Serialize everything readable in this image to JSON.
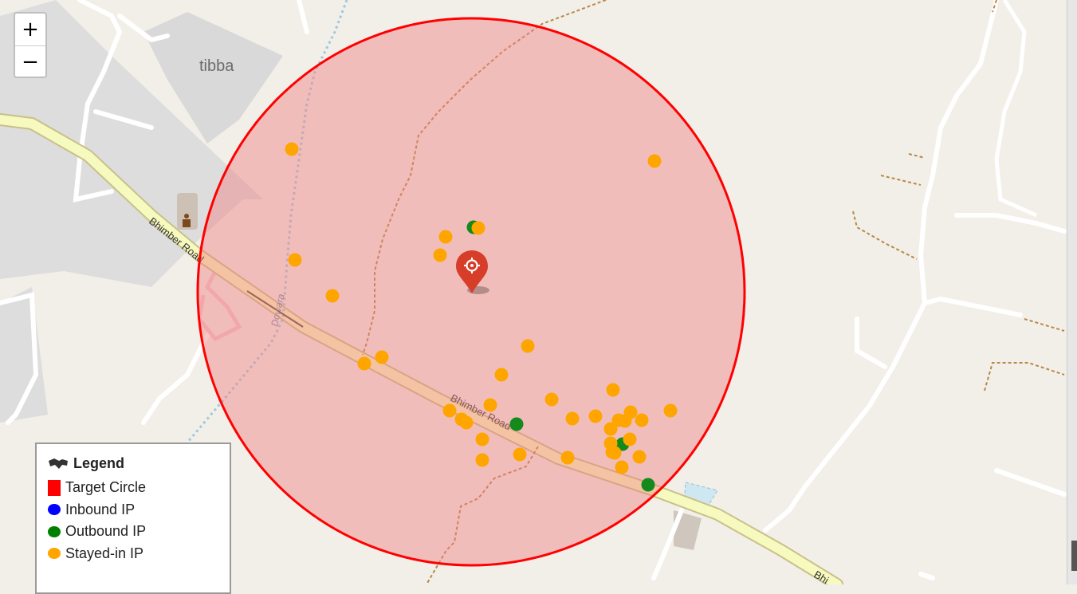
{
  "map": {
    "place_label": "tibba",
    "road_label_1": "Bhimber Road",
    "road_label_2": "Bhimber Road",
    "road_label_3": "Bhi",
    "stream_label": "Dowara"
  },
  "zoom": {
    "in_label": "+",
    "out_label": "−"
  },
  "legend": {
    "title": "Legend",
    "items": [
      {
        "label": "Target Circle",
        "color": "#ff0000"
      },
      {
        "label": "Inbound IP",
        "color": "#0000ff"
      },
      {
        "label": "Outbound IP",
        "color": "#008000"
      },
      {
        "label": "Stayed-in IP",
        "color": "#ffa500"
      }
    ]
  },
  "colors": {
    "circle_stroke": "#ff0000",
    "circle_fill": "#f08080",
    "outbound": "#138a1b",
    "stayed_in": "#ffa500",
    "marker": "#d63e2a"
  },
  "icons": [
    "map-icon",
    "target-marker-icon",
    "crosshair-icon",
    "police-icon"
  ]
}
